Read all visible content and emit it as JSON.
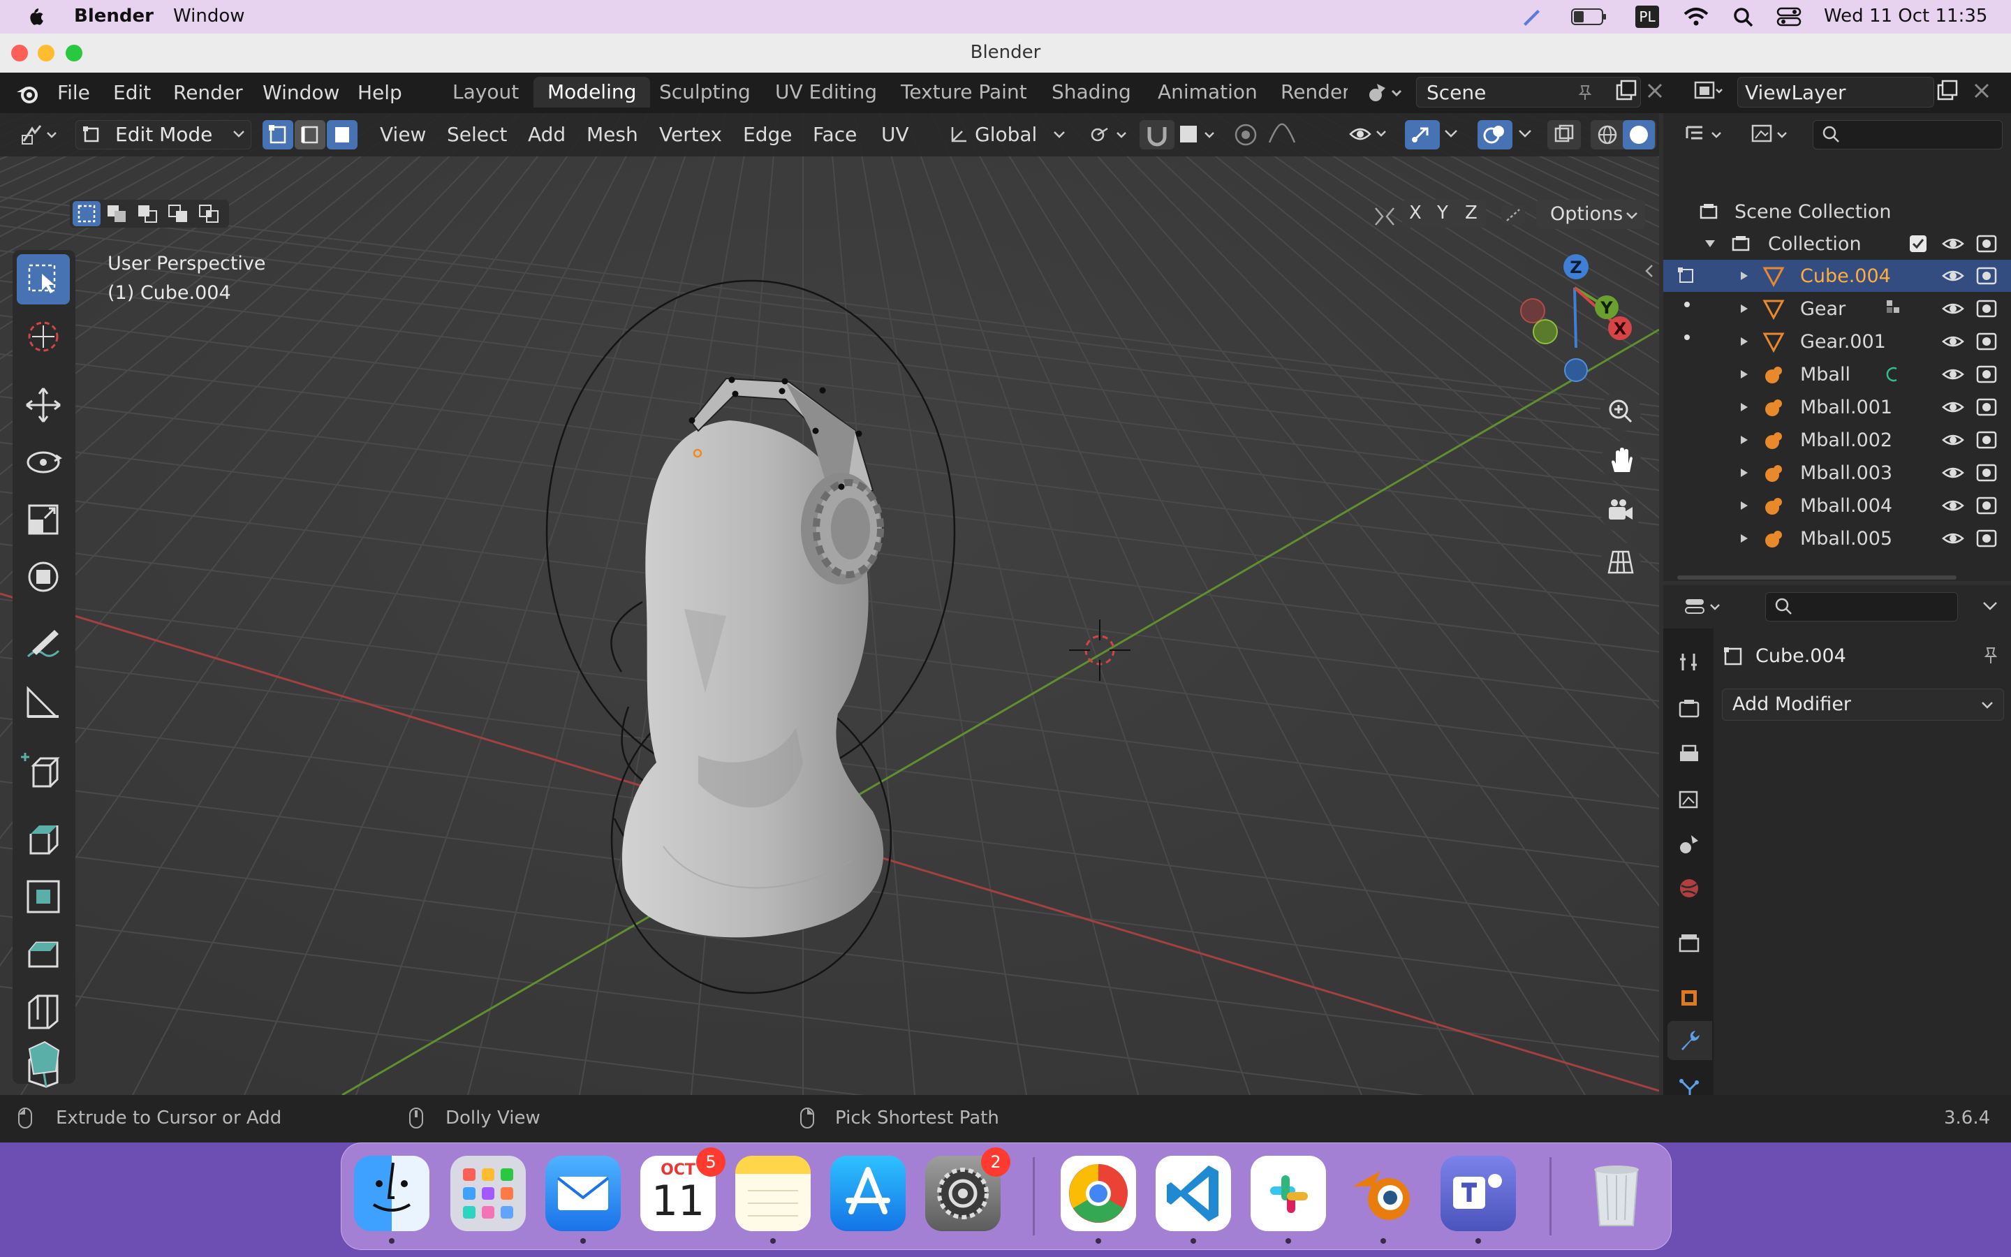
{
  "menubar": {
    "app_name": "Blender",
    "items": [
      "Window"
    ],
    "input_source": "PL",
    "datetime": "Wed 11 Oct  11:35"
  },
  "window": {
    "title": "Blender"
  },
  "topbar": {
    "menus": [
      "File",
      "Edit",
      "Render",
      "Window",
      "Help"
    ],
    "workspaces": [
      "Layout",
      "Modeling",
      "Sculpting",
      "UV Editing",
      "Texture Paint",
      "Shading",
      "Animation",
      "Renderi"
    ],
    "active_workspace": "Modeling",
    "scene": "Scene",
    "view_layer": "ViewLayer"
  },
  "viewport": {
    "mode": "Edit Mode",
    "menus": [
      "View",
      "Select",
      "Add",
      "Mesh",
      "Vertex",
      "Edge",
      "Face",
      "UV"
    ],
    "transform_orientation": "Global",
    "overlay_text_1": "User Perspective",
    "overlay_text_2": "(1) Cube.004",
    "axes": [
      "X",
      "Y",
      "Z"
    ],
    "options_label": "Options",
    "gizmo": {
      "x": "X",
      "y": "Y",
      "z": "Z"
    }
  },
  "outliner": {
    "scene_collection": "Scene Collection",
    "collection": "Collection",
    "items": [
      {
        "name": "Cube.004",
        "type": "mesh"
      },
      {
        "name": "Gear",
        "type": "mesh"
      },
      {
        "name": "Gear.001",
        "type": "mesh"
      },
      {
        "name": "Mball",
        "type": "metaball"
      },
      {
        "name": "Mball.001",
        "type": "metaball"
      },
      {
        "name": "Mball.002",
        "type": "metaball"
      },
      {
        "name": "Mball.003",
        "type": "metaball"
      },
      {
        "name": "Mball.004",
        "type": "metaball"
      },
      {
        "name": "Mball.005",
        "type": "metaball"
      }
    ],
    "selected": "Cube.004"
  },
  "properties": {
    "object_name": "Cube.004",
    "add_modifier": "Add Modifier"
  },
  "statusbar": {
    "hint1": "Extrude to Cursor or Add",
    "hint2": "Dolly View",
    "hint3": "Pick Shortest Path",
    "version": "3.6.4"
  },
  "dock": {
    "calendar_month": "OCT",
    "calendar_day": "11",
    "calendar_badge": "5",
    "settings_badge": "2",
    "apps": [
      "finder-icon",
      "launchpad-icon",
      "mail-icon",
      "calendar-icon",
      "notes-icon",
      "app-store-icon",
      "system-settings-icon",
      "chrome-icon",
      "vscode-icon",
      "slack-icon",
      "blender-icon",
      "teams-icon",
      "trash-icon"
    ]
  },
  "colors": {
    "accent": "#4772b3",
    "selected_text": "#ffae3b",
    "x_axis": "#b53a3a",
    "y_axis": "#6aa030",
    "z_axis": "#3f7fd6"
  }
}
